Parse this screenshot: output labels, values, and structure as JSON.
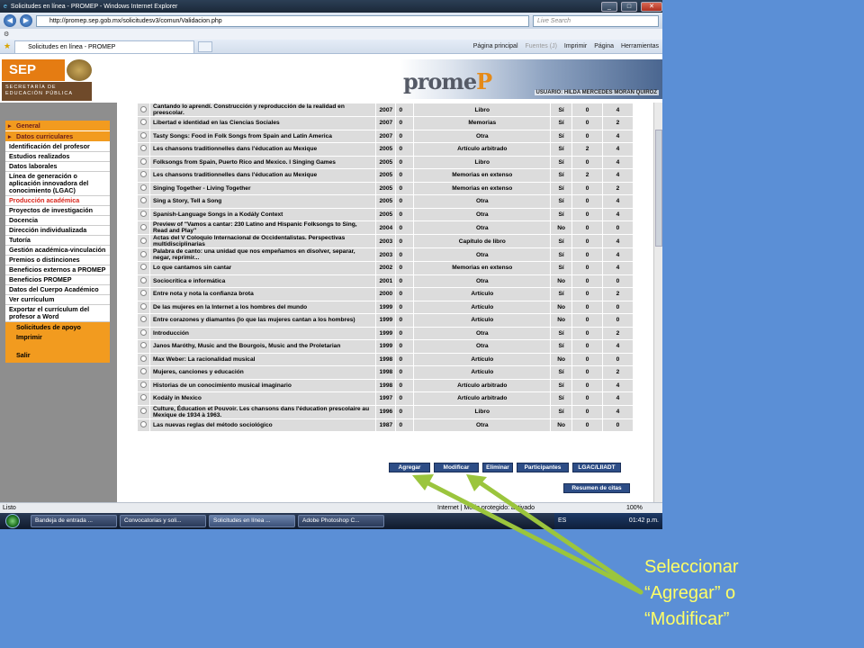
{
  "browser": {
    "window_title": "Solicitudes en línea - PROMEP - Windows Internet Explorer",
    "url": "http://promep.sep.gob.mx/solicitudesv3/comun/Validacion.php",
    "search_placeholder": "Live Search",
    "tab_label": "Solicitudes en línea - PROMEP",
    "cmd_home": "Página principal",
    "cmd_feeds": "Fuentes (J)",
    "cmd_print": "Imprimir",
    "cmd_page": "Página",
    "cmd_tools": "Herramientas"
  },
  "header": {
    "sep_logo": "SEP",
    "sep_subtitle": "SECRETARÍA DE EDUCACIÓN PÚBLICA",
    "brand_a": "prome",
    "brand_b": "P",
    "user_line": "USUARIO: HILDA MERCEDES MORAN QUIROZ"
  },
  "sidebar": {
    "general": "General",
    "datos_curriculares": "Datos curriculares",
    "items": [
      "Identificación del profesor",
      "Estudios realizados",
      "Datos laborales",
      "Línea de generación o aplicación innovadora del conocimiento (LGAC)",
      "Producción académica",
      "Proyectos de investigación",
      "Docencia",
      "Dirección individualizada",
      "Tutoría",
      "Gestión académica-vinculación",
      "Premios o distinciones",
      "Beneficios externos a PROMEP",
      "Beneficios PROMEP",
      "Datos del Cuerpo Académico",
      "Ver currículum",
      "Exportar el currículum del profesor a Word"
    ],
    "solicitudes": "Solicitudes de apoyo",
    "imprimir": "Imprimir",
    "salir": "Salir"
  },
  "table": {
    "rows": [
      [
        "Cantando lo aprendí. Construcción y reproducción de la realidad en preescolar.",
        "2007",
        "0",
        "Libro",
        "Sí",
        "0",
        "4"
      ],
      [
        "Libertad e identidad en las Ciencias Sociales",
        "2007",
        "0",
        "Memorias",
        "Sí",
        "0",
        "2"
      ],
      [
        "Tasty Songs: Food in Folk Songs from Spain and Latin America",
        "2007",
        "0",
        "Otra",
        "Sí",
        "0",
        "4"
      ],
      [
        "Les chansons traditionnelles dans l'éducation au Mexique",
        "2005",
        "0",
        "Artículo arbitrado",
        "Sí",
        "2",
        "4"
      ],
      [
        "Folksongs from Spain, Puerto Rico and Mexico. I Singing Games",
        "2005",
        "0",
        "Libro",
        "Sí",
        "0",
        "4"
      ],
      [
        "Les chansons traditionnelles dans l'éducation au Mexique",
        "2005",
        "0",
        "Memorias en extenso",
        "Sí",
        "2",
        "4"
      ],
      [
        "Singing Together - Living Together",
        "2005",
        "0",
        "Memorias en extenso",
        "Sí",
        "0",
        "2"
      ],
      [
        "Sing a Story, Tell a Song",
        "2005",
        "0",
        "Otra",
        "Sí",
        "0",
        "4"
      ],
      [
        "Spanish-Language Songs in a Kodály Context",
        "2005",
        "0",
        "Otra",
        "Sí",
        "0",
        "4"
      ],
      [
        "Preview of \"Vamos a cantar: 230 Latino and Hispanic Folksongs to Sing, Read and Play\"",
        "2004",
        "0",
        "Otra",
        "No",
        "0",
        "0"
      ],
      [
        "Actas del V Coloquio Internacional de Occidentalistas. Perspectivas multidisciplinarias",
        "2003",
        "0",
        "Capítulo de libro",
        "Sí",
        "0",
        "4"
      ],
      [
        "Palabra de canto: una unidad que nos empeñamos en disolver, separar, negar, reprimir...",
        "2003",
        "0",
        "Otra",
        "Sí",
        "0",
        "4"
      ],
      [
        "Lo que cantamos sin cantar",
        "2002",
        "0",
        "Memorias en extenso",
        "Sí",
        "0",
        "4"
      ],
      [
        "Sociocrítica e informática",
        "2001",
        "0",
        "Otra",
        "No",
        "0",
        "0"
      ],
      [
        "Entre nota y nota la confianza brota",
        "2000",
        "0",
        "Artículo",
        "Sí",
        "0",
        "2"
      ],
      [
        "De las mujeres en la Internet a los hombres del mundo",
        "1999",
        "0",
        "Artículo",
        "No",
        "0",
        "0"
      ],
      [
        "Entre corazones y diamantes (lo que las mujeres cantan a los hombres)",
        "1999",
        "0",
        "Artículo",
        "No",
        "0",
        "0"
      ],
      [
        "Introducción",
        "1999",
        "0",
        "Otra",
        "Sí",
        "0",
        "2"
      ],
      [
        "Janos Maróthy, Music and the Bourgois, Music and the Proletarian",
        "1999",
        "0",
        "Otra",
        "Sí",
        "0",
        "4"
      ],
      [
        "Max Weber: La racionalidad musical",
        "1998",
        "0",
        "Artículo",
        "No",
        "0",
        "0"
      ],
      [
        "Mujeres, canciones y educación",
        "1998",
        "0",
        "Artículo",
        "Sí",
        "0",
        "2"
      ],
      [
        "Historias de un conocimiento musical imaginario",
        "1998",
        "0",
        "Artículo arbitrado",
        "Sí",
        "0",
        "4"
      ],
      [
        "Kodály in Mexico",
        "1997",
        "0",
        "Artículo arbitrado",
        "Sí",
        "0",
        "4"
      ],
      [
        "Culture, Éducation et Pouvoir. Les chansons dans l'éducation prescolaire au Mexique de 1934 à 1963.",
        "1996",
        "0",
        "Libro",
        "Sí",
        "0",
        "4"
      ],
      [
        "Las nuevas reglas del método sociológico",
        "1987",
        "0",
        "Otra",
        "No",
        "0",
        "0"
      ]
    ]
  },
  "buttons": {
    "agregar": "Agregar",
    "modificar": "Modificar",
    "eliminar": "Eliminar",
    "participantes": "Participantes",
    "lgac": "LGAC/LIIADT",
    "resumen": "Resumen de citas"
  },
  "status": {
    "left": "Listo",
    "zone": "Internet | Modo protegido: activado",
    "zoom": "100%"
  },
  "taskbar": {
    "items": [
      "Bandeja de entrada ...",
      "Convocatorias y soli...",
      "Solicitudes en línea ...",
      "Adobe Photoshop C..."
    ],
    "lang": "ES",
    "time": "01:42 p.m."
  },
  "annotation": {
    "line1": "Seleccionar",
    "line2": "“Agregar” o",
    "line3": "“Modificar”",
    "arrow_color": "#9bc53d",
    "text_color": "#ffff66"
  }
}
